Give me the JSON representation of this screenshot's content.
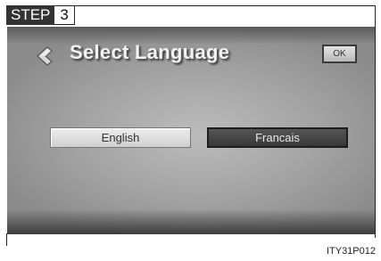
{
  "step": {
    "label": "STEP",
    "number": "3"
  },
  "screen": {
    "title": "Select Language",
    "back_icon": "back-arrow-icon",
    "ok_label": "OK",
    "languages": [
      {
        "label": "English",
        "selected": false
      },
      {
        "label": "Francais",
        "selected": true
      }
    ]
  },
  "caption": "ITY31P012"
}
